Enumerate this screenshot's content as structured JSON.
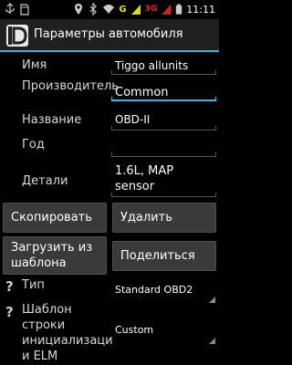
{
  "status_bar": {
    "network_g": "G",
    "network_3g": "3G",
    "time": "11:11"
  },
  "action_bar": {
    "title": "Параметры автомобиля",
    "logo_letters": "D"
  },
  "form": {
    "name": {
      "label": "Имя",
      "value": "Tiggo allunits"
    },
    "manufacturer": {
      "label": "Производитель",
      "value": "Common"
    },
    "model": {
      "label": "Название",
      "value": "OBD-II"
    },
    "year": {
      "label": "Год",
      "value": ""
    },
    "details": {
      "label": "Детали",
      "value_line1": "1.6L, MAP",
      "value_line2": "sensor"
    }
  },
  "buttons": {
    "copy": "Скопировать",
    "delete": "Удалить",
    "load_template_line1": "Загрузить из",
    "load_template_line2": "шаблона",
    "share": "Поделиться"
  },
  "type_row": {
    "help": "?",
    "label": "Тип",
    "value": "Standard OBD2"
  },
  "init_row": {
    "help": "?",
    "label_line1": "Шаблон",
    "label_line2": "строки",
    "label_line3": "инициализаци",
    "label_line4": "и ELM",
    "value": "Custom"
  },
  "colors": {
    "accent": "#33b5e5",
    "background": "#000000",
    "button": "#3a3a3a"
  }
}
